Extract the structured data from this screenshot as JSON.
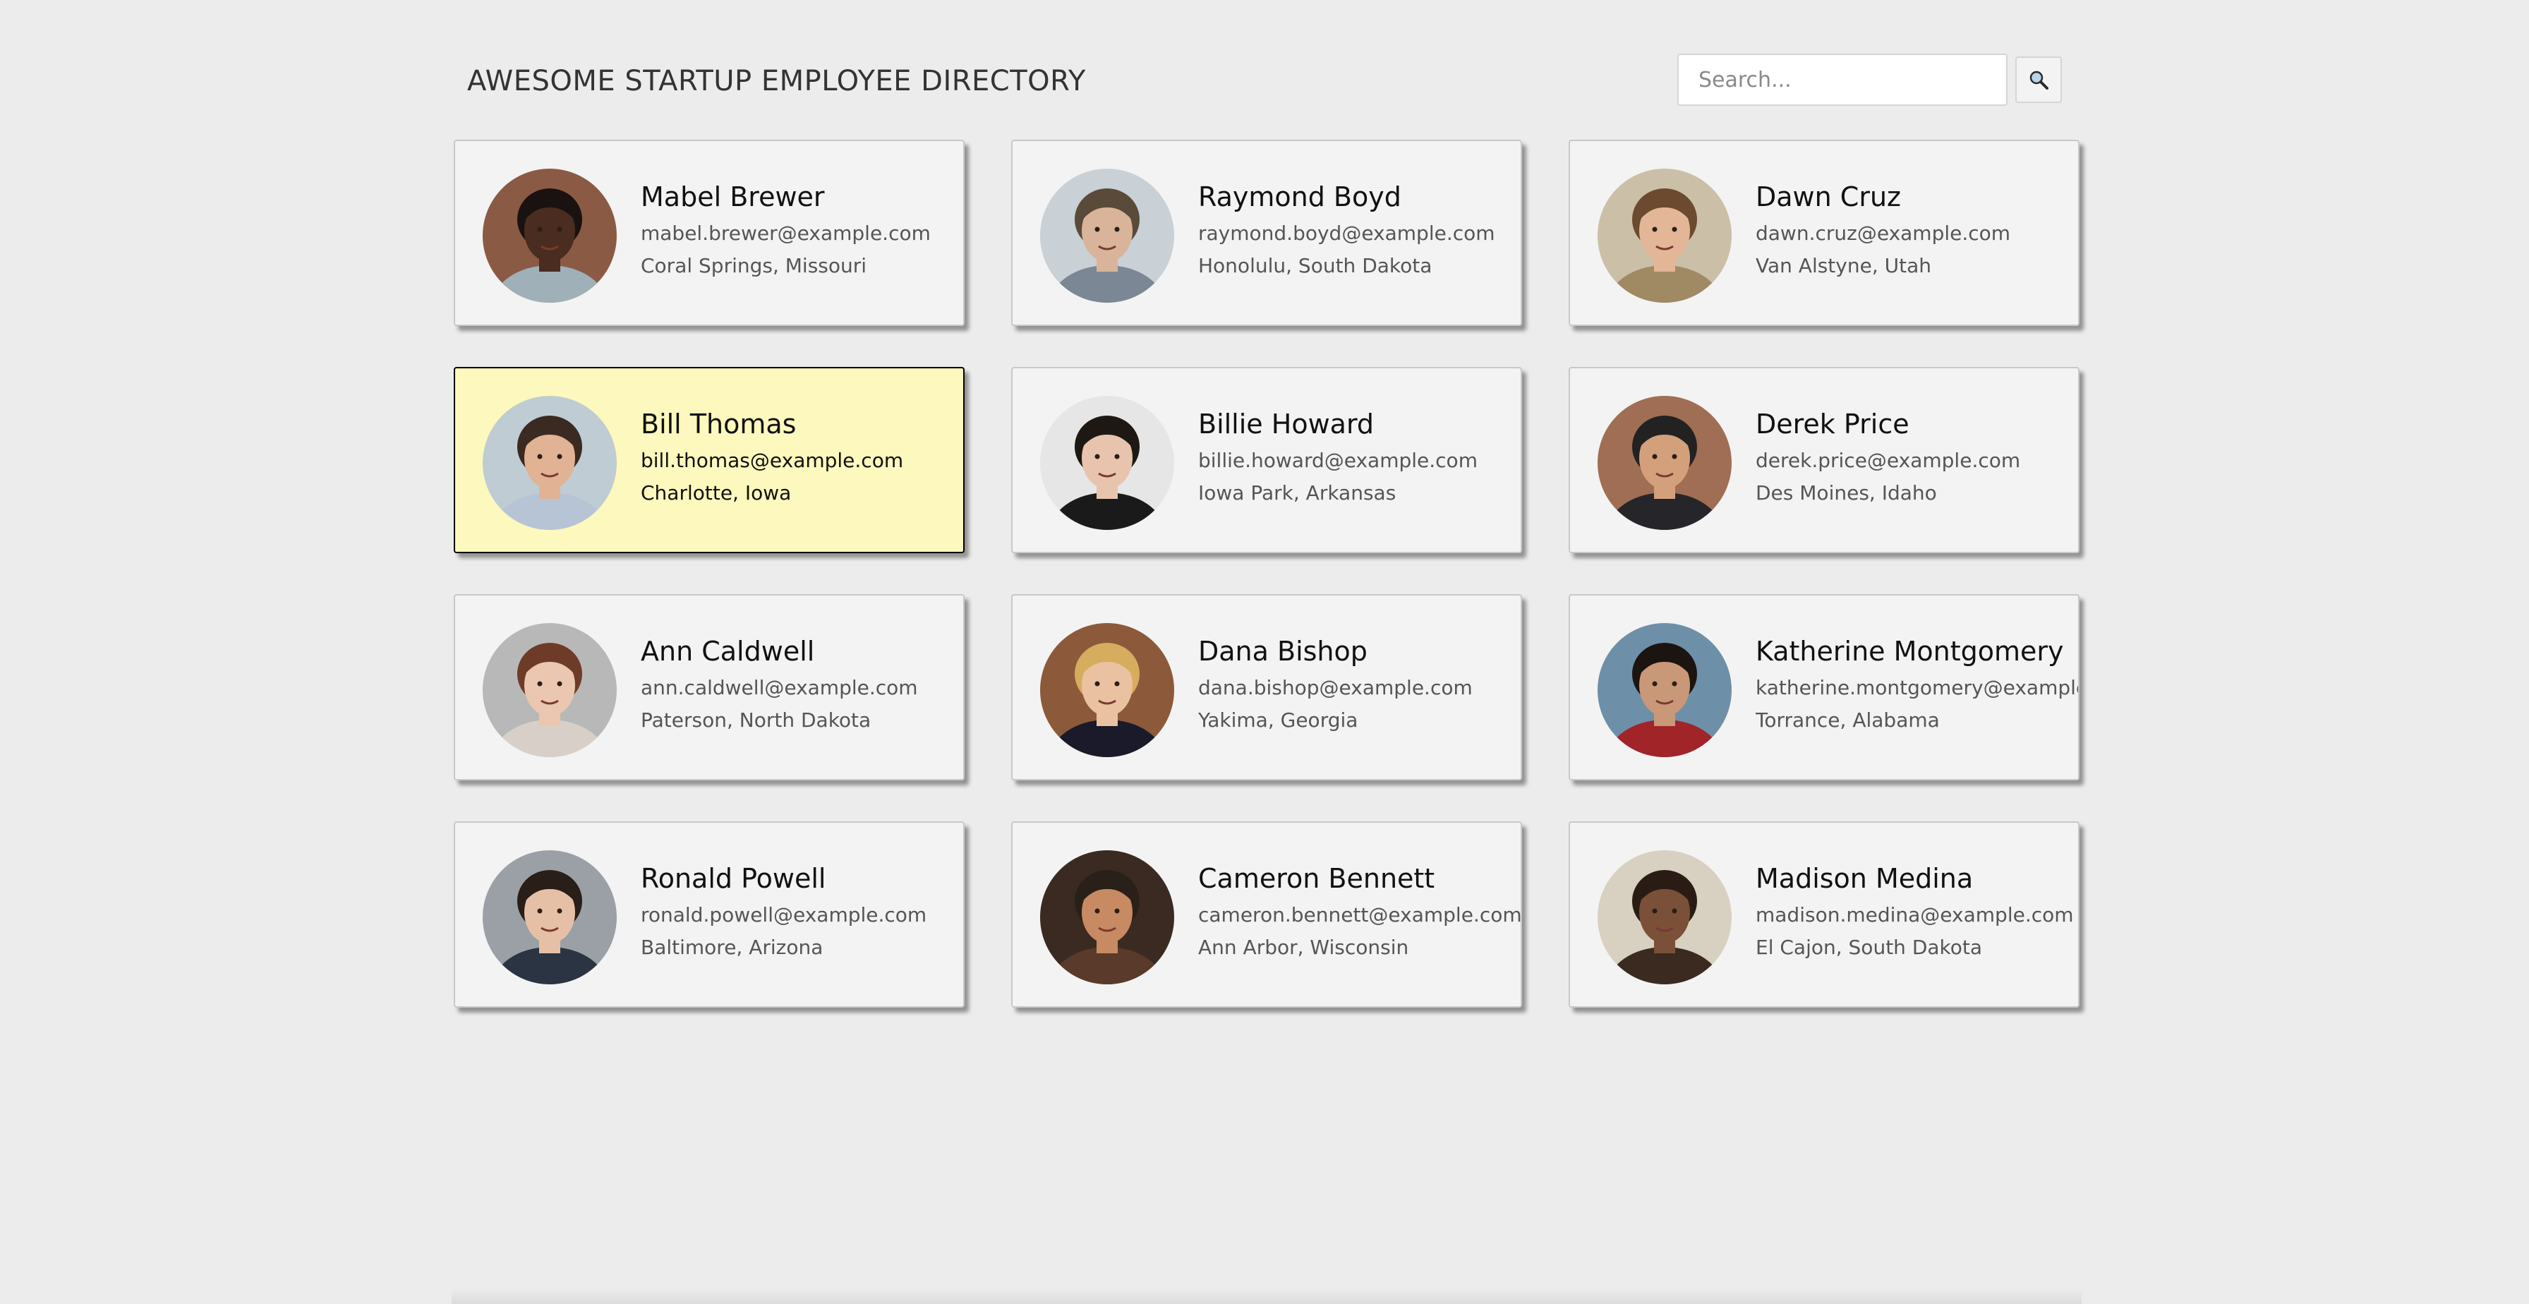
{
  "header": {
    "title": "AWESOME STARTUP EMPLOYEE DIRECTORY",
    "search_placeholder": "Search...",
    "search_value": "",
    "search_button_icon": "magnifier-icon"
  },
  "employees": [
    {
      "name": "Mabel Brewer",
      "email": "mabel.brewer@example.com",
      "location": "Coral Springs, Missouri",
      "selected": false,
      "avatar_colors": {
        "bg": "#8b5a44",
        "skin": "#4a2c20",
        "hair": "#1a1210",
        "shirt": "#9fb0b8"
      }
    },
    {
      "name": "Raymond Boyd",
      "email": "raymond.boyd@example.com",
      "location": "Honolulu, South Dakota",
      "selected": false,
      "avatar_colors": {
        "bg": "#c9d0d6",
        "skin": "#d9b49a",
        "hair": "#5a4a3a",
        "shirt": "#7b8794"
      }
    },
    {
      "name": "Dawn Cruz",
      "email": "dawn.cruz@example.com",
      "location": "Van Alstyne, Utah",
      "selected": false,
      "avatar_colors": {
        "bg": "#cbbfa8",
        "skin": "#e3b697",
        "hair": "#6b4a2f",
        "shirt": "#a08a64"
      }
    },
    {
      "name": "Bill Thomas",
      "email": "bill.thomas@example.com",
      "location": "Charlotte, Iowa",
      "selected": true,
      "avatar_colors": {
        "bg": "#c0ccd3",
        "skin": "#e1b294",
        "hair": "#3b2a22",
        "shirt": "#b7c4d6"
      }
    },
    {
      "name": "Billie Howard",
      "email": "billie.howard@example.com",
      "location": "Iowa Park, Arkansas",
      "selected": false,
      "avatar_colors": {
        "bg": "#e6e6e6",
        "skin": "#e8c4ae",
        "hair": "#1e1814",
        "shirt": "#1a1a1a"
      }
    },
    {
      "name": "Derek Price",
      "email": "derek.price@example.com",
      "location": "Des Moines, Idaho",
      "selected": false,
      "avatar_colors": {
        "bg": "#a06e54",
        "skin": "#d4a07c",
        "hair": "#222222",
        "shirt": "#26262a"
      }
    },
    {
      "name": "Ann Caldwell",
      "email": "ann.caldwell@example.com",
      "location": "Paterson, North Dakota",
      "selected": false,
      "avatar_colors": {
        "bg": "#b8b8b8",
        "skin": "#ebc6b0",
        "hair": "#6e3b28",
        "shirt": "#d8d0c8"
      }
    },
    {
      "name": "Dana Bishop",
      "email": "dana.bishop@example.com",
      "location": "Yakima, Georgia",
      "selected": false,
      "avatar_colors": {
        "bg": "#8c5a3a",
        "skin": "#eac2a2",
        "hair": "#d6ac5e",
        "shirt": "#1a1a2a"
      }
    },
    {
      "name": "Katherine Montgomery",
      "email": "katherine.montgomery@example.com",
      "location": "Torrance, Alabama",
      "selected": false,
      "avatar_colors": {
        "bg": "#6e8fa8",
        "skin": "#c99878",
        "hair": "#1c1410",
        "shirt": "#a02428"
      }
    },
    {
      "name": "Ronald Powell",
      "email": "ronald.powell@example.com",
      "location": "Baltimore, Arizona",
      "selected": false,
      "avatar_colors": {
        "bg": "#9aa0a6",
        "skin": "#e6c0a6",
        "hair": "#2a1e18",
        "shirt": "#2a3442"
      }
    },
    {
      "name": "Cameron Bennett",
      "email": "cameron.bennett@example.com",
      "location": "Ann Arbor, Wisconsin",
      "selected": false,
      "avatar_colors": {
        "bg": "#3a2a22",
        "skin": "#c88a62",
        "hair": "#2a201a",
        "shirt": "#5a3a2a"
      }
    },
    {
      "name": "Madison Medina",
      "email": "madison.medina@example.com",
      "location": "El Cajon, South Dakota",
      "selected": false,
      "avatar_colors": {
        "bg": "#d8d0c0",
        "skin": "#7a5038",
        "hair": "#2a1c14",
        "shirt": "#3a2a20"
      }
    }
  ]
}
